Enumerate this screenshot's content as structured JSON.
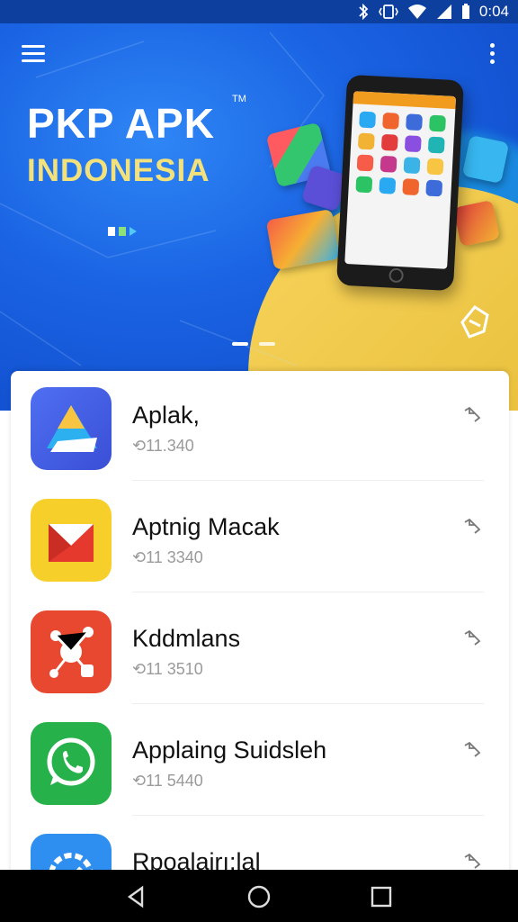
{
  "status_bar": {
    "time": "0:04",
    "icons": [
      "bluetooth-icon",
      "vibrate-icon",
      "wifi-icon",
      "signal-icon",
      "battery-icon"
    ]
  },
  "header": {
    "menu_icon": "hamburger-menu-icon",
    "overflow_icon": "more-vertical-icon"
  },
  "hero": {
    "title": "PKP APK",
    "trademark": "TM",
    "subtitle": "INDONESIA",
    "carousel_pages": 2,
    "colors": {
      "primary": "#1a63e3",
      "title": "#ffffff",
      "subtitle": "#f3e27c",
      "accent_yellow": "#e9c03a"
    }
  },
  "apps": [
    {
      "name": "Aplak,",
      "meta": "⟲11.340",
      "icon": "drive-triangle-icon"
    },
    {
      "name": "Aptnig Macak",
      "meta": "⟲11 3340",
      "icon": "red-envelope-icon"
    },
    {
      "name": "Kddmlans",
      "meta": "⟲11 3510",
      "icon": "network-nodes-icon"
    },
    {
      "name": "Applaing Suidsleh",
      "meta": "⟲11 5440",
      "icon": "chat-phone-icon"
    },
    {
      "name": "Rpoalairı:lal",
      "meta": "",
      "icon": "gear-check-icon"
    }
  ],
  "nav_bar": {
    "back_icon": "back-triangle-icon",
    "home_icon": "home-circle-icon",
    "recents_icon": "recents-square-icon"
  }
}
